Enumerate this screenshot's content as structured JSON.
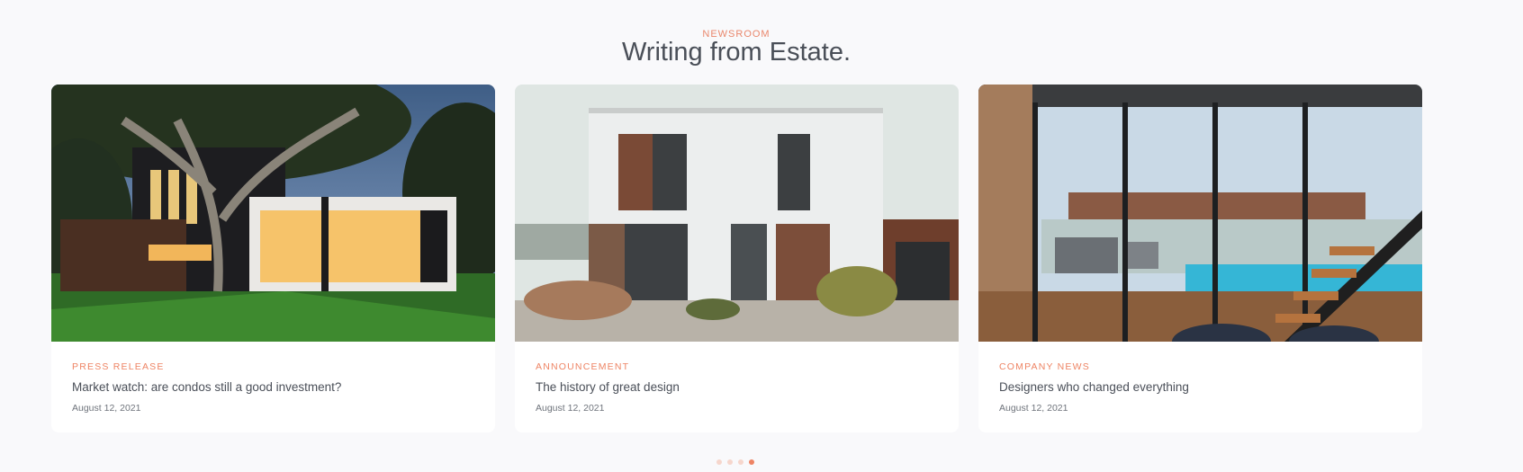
{
  "section": {
    "eyebrow": "NEWSROOM",
    "title": "Writing from Estate."
  },
  "cards": [
    {
      "category": "PRESS RELEASE",
      "title": "Market watch: are condos still a good investment?",
      "date": "August 12, 2021"
    },
    {
      "category": "ANNOUNCEMENT",
      "title": "The history of great design",
      "date": "August 12, 2021"
    },
    {
      "category": "COMPANY NEWS",
      "title": "Designers who changed everything",
      "date": "August 12, 2021"
    }
  ],
  "pagination": {
    "pages": 4,
    "active_page": 4
  },
  "colors": {
    "accent": "#ee8464",
    "heading": "#4a4f58",
    "background": "#f9f9fb"
  }
}
